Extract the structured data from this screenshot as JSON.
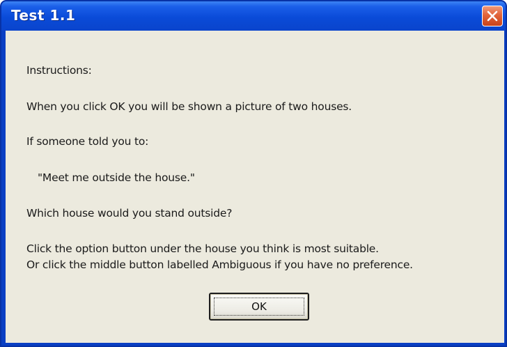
{
  "window": {
    "title": "Test 1.1"
  },
  "icons": {
    "close": "close-icon"
  },
  "colors": {
    "titlebar": "#0a4bd8",
    "close_button": "#e2643a",
    "client_background": "#eceade"
  },
  "dialog": {
    "heading": "Instructions:",
    "line_1": "When you click OK you will be shown a picture of two houses.",
    "line_2": "If someone told you to:",
    "quote": "\"Meet me outside the house.\"",
    "question": "Which house would you stand outside?",
    "instruction_1": "Click the option button under the house you think is most suitable.",
    "instruction_2": "Or click the middle button labelled Ambiguous if you have no preference.",
    "ok_label": "OK"
  }
}
